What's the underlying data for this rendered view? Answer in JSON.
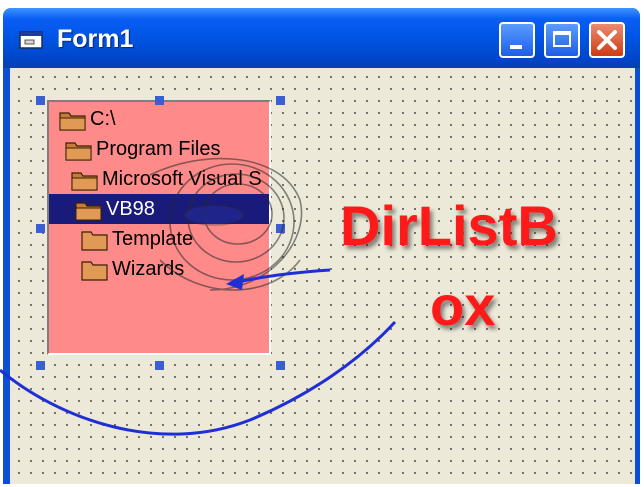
{
  "window": {
    "title": "Form1",
    "icons": {
      "app": "form-icon",
      "minimize": "minimize-icon",
      "maximize": "maximize-icon",
      "close": "close-icon"
    }
  },
  "dir_list": {
    "items": [
      {
        "label": "C:\\",
        "selected": false
      },
      {
        "label": "Program Files",
        "selected": false
      },
      {
        "label": "Microsoft Visual S",
        "selected": false
      },
      {
        "label": "VB98",
        "selected": true
      },
      {
        "label": "Template",
        "selected": false
      },
      {
        "label": "Wizards",
        "selected": false
      }
    ]
  },
  "annotation": {
    "line1": "DirListB",
    "line2": "ox"
  },
  "colors": {
    "titlebar": "#0054e3",
    "form_bg": "#ece9d8",
    "listbox_bg": "#ff8a8a",
    "selection": "#1a1a7a",
    "annotation_text": "#ff1a1a",
    "arrow": "#1f2fd6"
  }
}
